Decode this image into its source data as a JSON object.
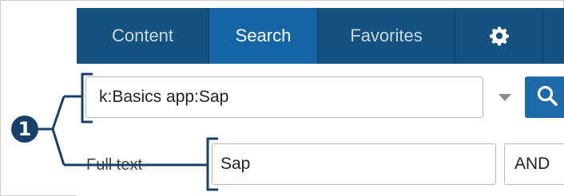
{
  "nav": {
    "tabs": [
      {
        "label": "Content",
        "active": false
      },
      {
        "label": "Search",
        "active": true
      },
      {
        "label": "Favorites",
        "active": false
      }
    ],
    "settings_icon": "gear-icon"
  },
  "search": {
    "query": "k:Basics app:Sap",
    "button_icon": "search-icon"
  },
  "fulltext": {
    "label": "Full text",
    "value": "Sap",
    "operator": "AND"
  },
  "callout": {
    "number": "1"
  },
  "colors": {
    "nav_bg": "#14517e",
    "active_tab": "#1565a6",
    "button": "#1d6aa8",
    "callout": "#17416b"
  }
}
